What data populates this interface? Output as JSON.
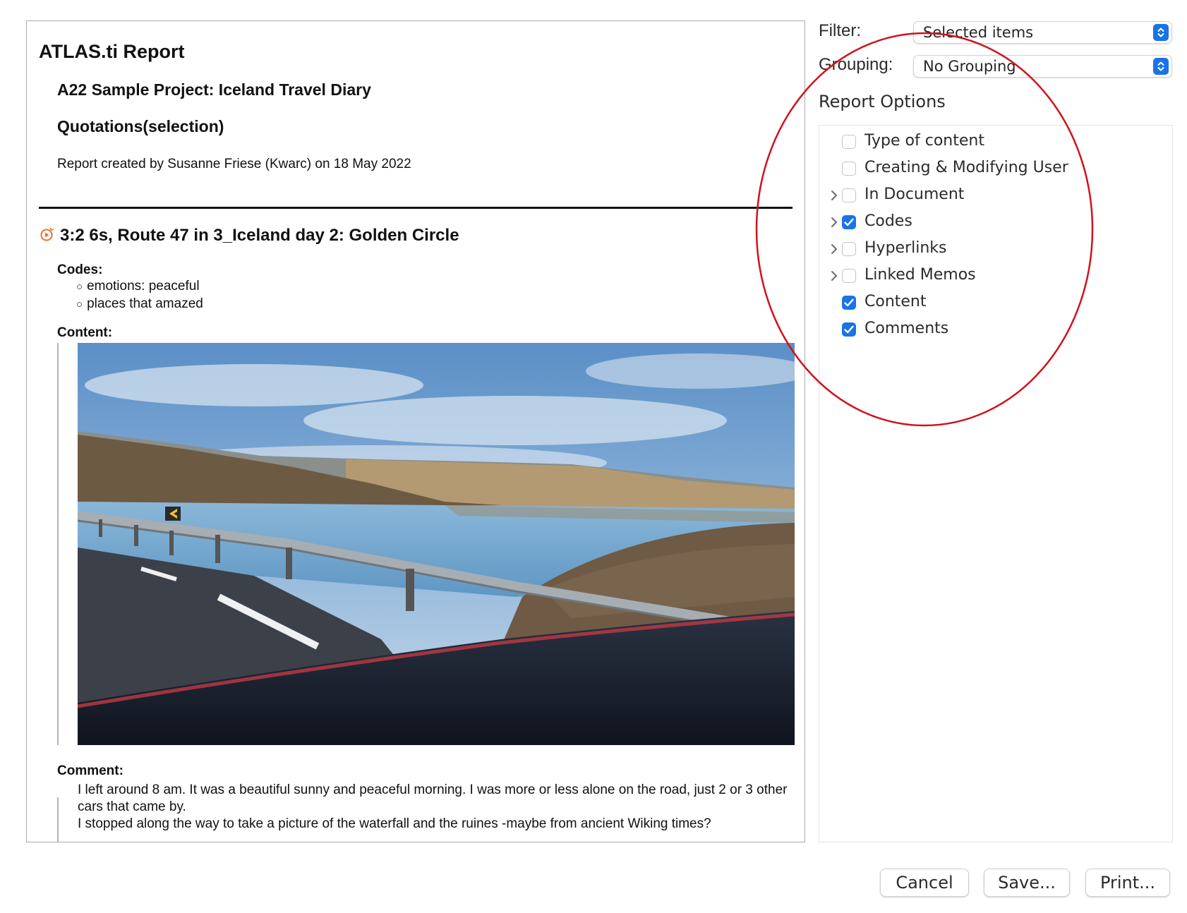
{
  "report": {
    "title": "ATLAS.ti Report",
    "project": "A22 Sample Project: Iceland Travel Diary",
    "section": "Quotations(selection)",
    "created": "Report created by Susanne Friese (Kwarc) on 18 May 2022",
    "quotation": {
      "heading": "3:2 6s, Route 47 in 3_Iceland day 2: Golden Circle",
      "icon": "video-quotation-icon",
      "codes_label": "Codes:",
      "codes": [
        "emotions: peaceful",
        "places that amazed"
      ],
      "content_label": "Content:",
      "image": "iceland-fjord-road-photo",
      "comment_label": "Comment:",
      "comment_lines": [
        "I left around 8 am. It was a beautiful sunny and peaceful morning. I was more or less alone on the road, just 2 or 3 other cars that came by.",
        "I stopped along the way to take a picture of the waterfall and the ruines -maybe from ancient Wiking times?"
      ]
    }
  },
  "filter": {
    "label": "Filter:",
    "value": "Selected items"
  },
  "grouping": {
    "label": "Grouping:",
    "value": "No Grouping"
  },
  "report_options": {
    "heading": "Report Options",
    "items": [
      {
        "label": "Type of content",
        "checked": false,
        "expandable": false
      },
      {
        "label": "Creating & Modifying User",
        "checked": false,
        "expandable": false
      },
      {
        "label": "In Document",
        "checked": false,
        "expandable": true
      },
      {
        "label": "Codes",
        "checked": true,
        "expandable": true
      },
      {
        "label": "Hyperlinks",
        "checked": false,
        "expandable": true
      },
      {
        "label": "Linked Memos",
        "checked": false,
        "expandable": true
      },
      {
        "label": "Content",
        "checked": true,
        "expandable": false
      },
      {
        "label": "Comments",
        "checked": true,
        "expandable": false
      }
    ]
  },
  "buttons": {
    "cancel": "Cancel",
    "save": "Save...",
    "print": "Print..."
  },
  "colors": {
    "accent": "#1a73e8",
    "annotation": "#d0121c"
  }
}
